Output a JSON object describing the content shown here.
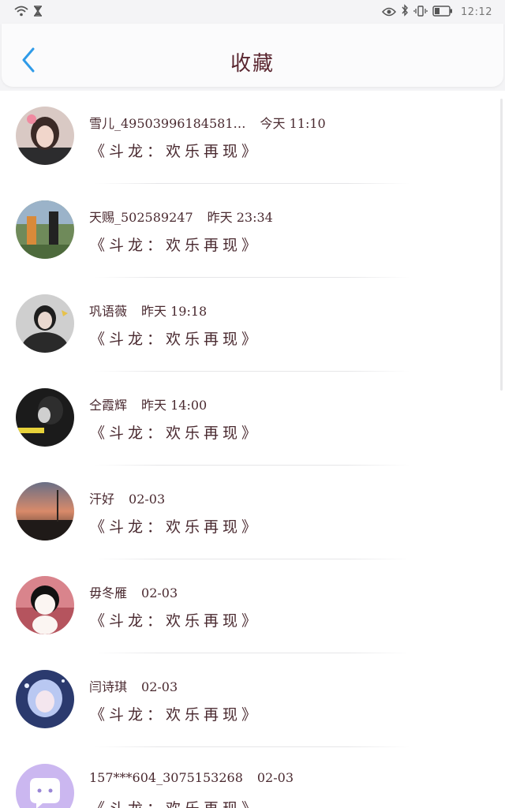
{
  "status": {
    "time": "12:12"
  },
  "header": {
    "title": "收藏"
  },
  "favorites": [
    {
      "name": "雪儿_49503996184581…",
      "date": "今天 11:10",
      "work": "《斗龙：欢乐再现》"
    },
    {
      "name": "天赐_502589247",
      "date": "昨天 23:34",
      "work": "《斗龙：欢乐再现》"
    },
    {
      "name": "巩语薇",
      "date": "昨天 19:18",
      "work": "《斗龙：欢乐再现》"
    },
    {
      "name": "仝霞辉",
      "date": "昨天 14:00",
      "work": "《斗龙：欢乐再现》"
    },
    {
      "name": "汗好",
      "date": "02-03",
      "work": "《斗龙：欢乐再现》"
    },
    {
      "name": "毋冬雁",
      "date": "02-03",
      "work": "《斗龙：欢乐再现》"
    },
    {
      "name": "闫诗琪",
      "date": "02-03",
      "work": "《斗龙：欢乐再现》"
    },
    {
      "name": "157***604_3075153268",
      "date": "02-03",
      "work": "《斗龙：欢乐再现》"
    }
  ],
  "colors": {
    "accent": "#2f9be8",
    "title": "#5a2630",
    "text": "#4a2a30"
  }
}
